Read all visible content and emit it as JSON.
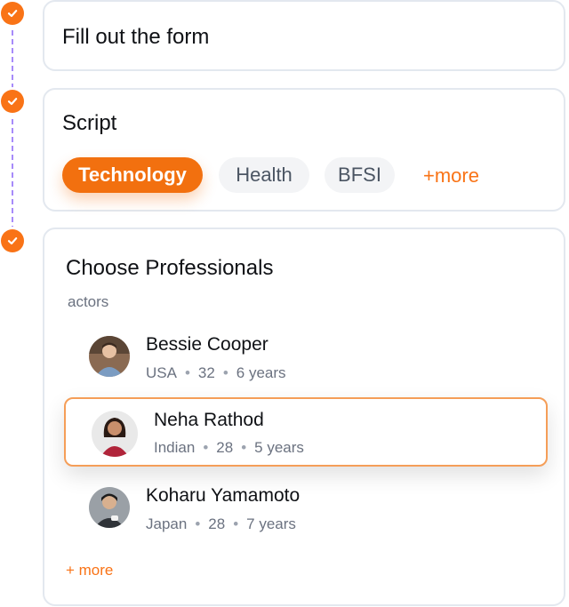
{
  "steps": {
    "step1": {
      "title": "Fill out the form"
    },
    "step2": {
      "title": "Script",
      "chips": [
        {
          "label": "Technology",
          "active": true
        },
        {
          "label": "Health",
          "active": false
        },
        {
          "label": "BFSI",
          "active": false
        }
      ],
      "more_label": "+more"
    },
    "step3": {
      "title": "Choose Professionals",
      "subtitle": "actors",
      "professionals": [
        {
          "name": "Bessie Cooper",
          "country": "USA",
          "age": "32",
          "experience": "6 years",
          "selected": false
        },
        {
          "name": "Neha Rathod",
          "country": "Indian",
          "age": "28",
          "experience": "5 years",
          "selected": true
        },
        {
          "name": "Koharu Yamamoto",
          "country": "Japan",
          "age": "28",
          "experience": "7 years",
          "selected": false
        }
      ],
      "more_label": "+ more"
    }
  },
  "colors": {
    "accent": "#f97316",
    "timeline": "#a78bfa",
    "card_border": "#e3e8ef",
    "selected_border": "#f59e58"
  },
  "icons": [
    "check-icon",
    "avatar"
  ]
}
